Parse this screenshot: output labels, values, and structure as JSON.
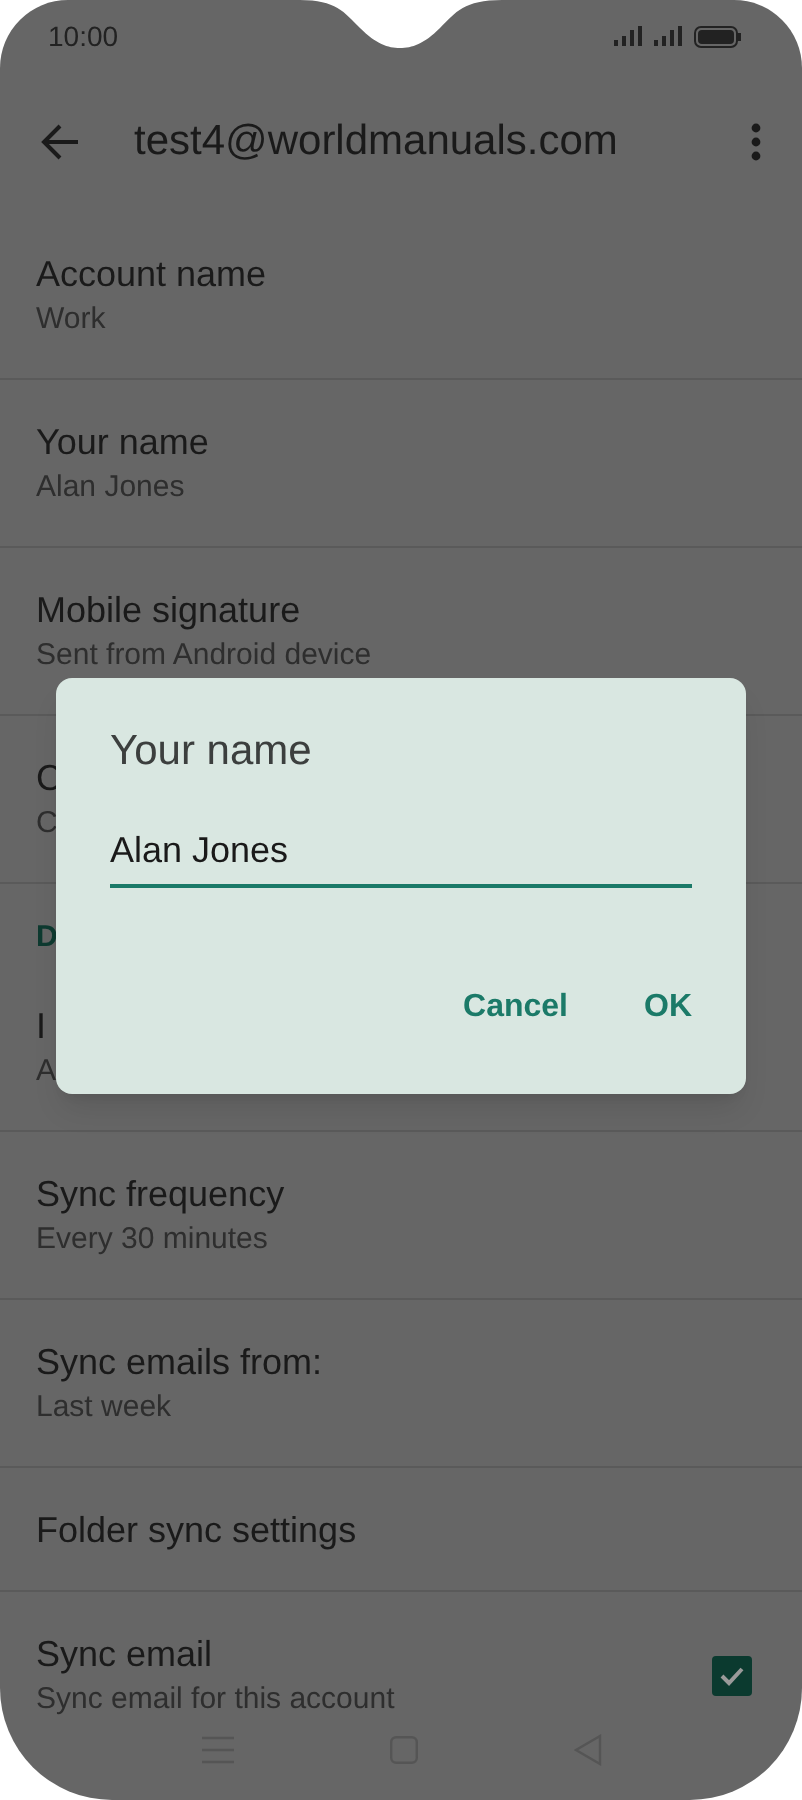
{
  "status_bar": {
    "time": "10:00"
  },
  "app_bar": {
    "title": "test4@worldmanuals.com"
  },
  "settings": [
    {
      "kind": "item",
      "title": "Account name",
      "summary": "Work"
    },
    {
      "kind": "item",
      "title": "Your name",
      "summary": "Alan Jones"
    },
    {
      "kind": "item",
      "title": "Mobile signature",
      "summary": "Sent from Android device"
    },
    {
      "kind": "item",
      "title": "C",
      "summary": "C"
    },
    {
      "kind": "header",
      "title": "D"
    },
    {
      "kind": "item",
      "title": "I",
      "summary": "A"
    },
    {
      "kind": "item",
      "title": "Sync frequency",
      "summary": "Every 30 minutes"
    },
    {
      "kind": "item",
      "title": "Sync emails from:",
      "summary": "Last week"
    },
    {
      "kind": "item",
      "title": "Folder sync settings"
    },
    {
      "kind": "checkbox",
      "title": "Sync email",
      "summary": "Sync email for this account",
      "checked": true
    }
  ],
  "dialog": {
    "title": "Your name",
    "value": "Alan Jones",
    "buttons": [
      "Cancel",
      "OK"
    ]
  }
}
